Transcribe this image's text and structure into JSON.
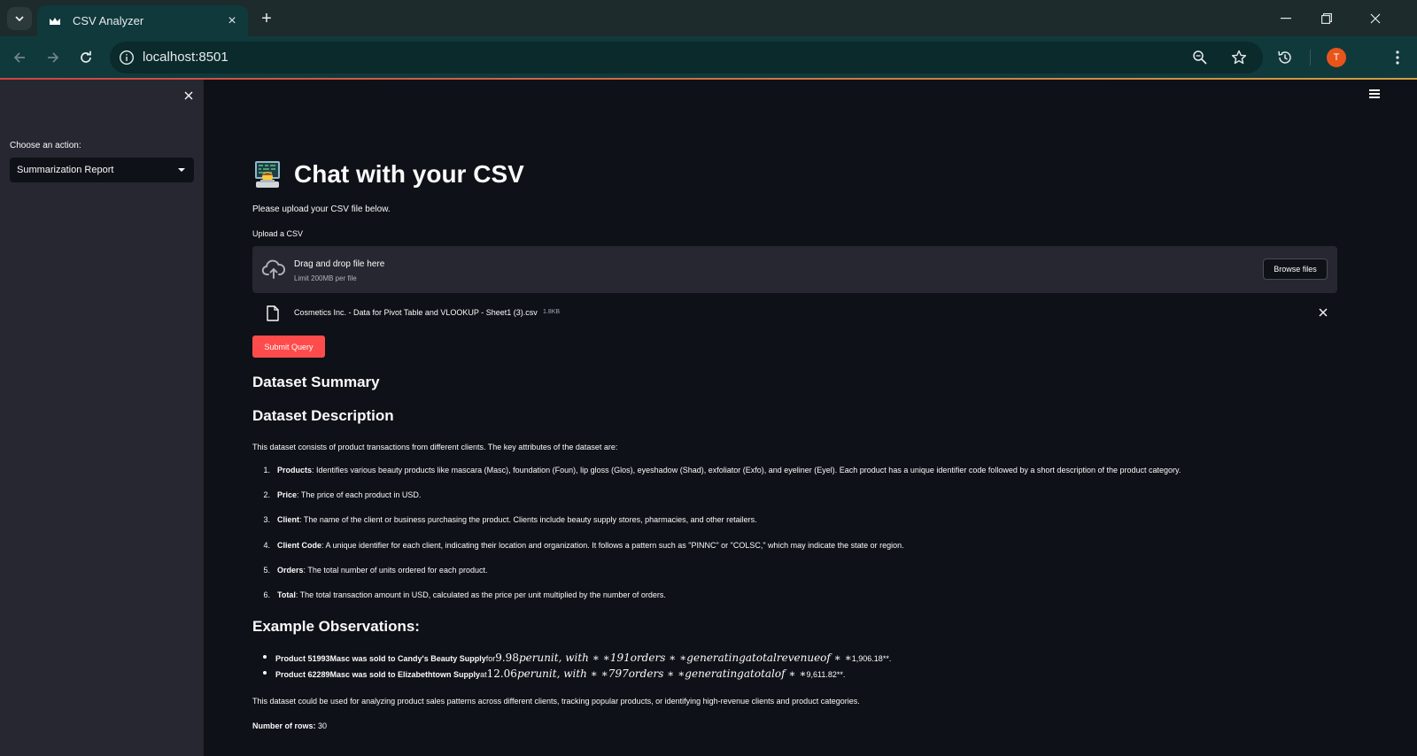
{
  "browser": {
    "tab_title": "CSV Analyzer",
    "url": "localhost:8501",
    "avatar_letter": "T"
  },
  "sidebar": {
    "choose_label": "Choose an action:",
    "selected_action": "Summarization Report"
  },
  "header": {
    "title": "Chat with your CSV",
    "upload_prompt": "Please upload your CSV file below."
  },
  "uploader": {
    "label": "Upload a CSV",
    "drop_title": "Drag and drop file here",
    "limit": "Limit 200MB per file",
    "browse_label": "Browse files",
    "file_name": "Cosmetics Inc. - Data for Pivot Table and VLOOKUP - Sheet1 (3).csv",
    "file_size": "1.8KB"
  },
  "submit_label": "Submit Query",
  "report": {
    "summary_heading": "Dataset Summary",
    "description_heading": "Dataset Description",
    "intro": "This dataset consists of product transactions from different clients. The key attributes of the dataset are:",
    "attributes": [
      {
        "num": "1.",
        "name": "Products",
        "text": ": Identifies various beauty products like mascara (Masc), foundation (Foun), lip gloss (Glos), eyeshadow (Shad), exfoliator (Exfo), and eyeliner (Eyel). Each product has a unique identifier code followed by a short description of the product category."
      },
      {
        "num": "2.",
        "name": "Price",
        "text": ": The price of each product in USD."
      },
      {
        "num": "3.",
        "name": "Client",
        "text": ": The name of the client or business purchasing the product. Clients include beauty supply stores, pharmacies, and other retailers."
      },
      {
        "num": "4.",
        "name": "Client Code",
        "text": ": A unique identifier for each client, indicating their location and organization. It follows a pattern such as \"PINNC\" or \"COLSC,\" which may indicate the state or region."
      },
      {
        "num": "5.",
        "name": "Orders",
        "text": ": The total number of units ordered for each product."
      },
      {
        "num": "6.",
        "name": "Total",
        "text": ": The total transaction amount in USD, calculated as the price per unit multiplied by the number of orders."
      }
    ],
    "observations_heading": "Example Observations:",
    "observations": [
      {
        "bold": "Product 51993Masc was sold to Candy's Beauty Supply",
        "plain": " for ",
        "math_num": "9.98",
        "math": "perunit, with ∗ ∗191orders ∗ ∗generatingatotalrevenueof ∗ ∗",
        "tail": "1,906.18**."
      },
      {
        "bold": "Product 62289Masc was sold to Elizabethtown Supply",
        "plain": " at ",
        "math_num": "12.06",
        "math": "perunit, with ∗ ∗797orders ∗ ∗generatingatotalof ∗ ∗",
        "tail": "9,611.82**."
      }
    ],
    "closing": "This dataset could be used for analyzing product sales patterns across different clients, tracking popular products, or identifying high-revenue clients and product categories.",
    "rows_label": "Number of rows:",
    "rows_value": "30"
  },
  "colors": {
    "primary": "#ff4b4b",
    "background": "#0e1117",
    "sidebar": "#262730",
    "browser_chrome": "#10393c"
  }
}
